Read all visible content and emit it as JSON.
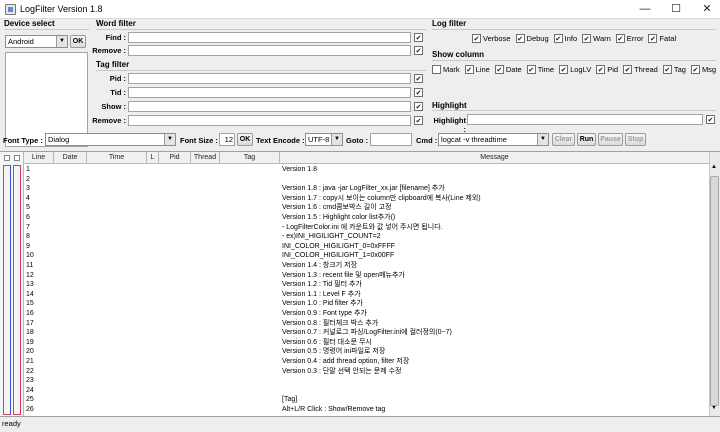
{
  "window": {
    "title": "LogFilter Version 1.8",
    "minimize": "—",
    "maximize": "☐",
    "close": "✕"
  },
  "device_select": {
    "title": "Device select",
    "selected": "Android",
    "ok": "OK"
  },
  "word_filter": {
    "title": "Word filter",
    "find_label": "Find :",
    "remove_label": "Remove :"
  },
  "tag_filter": {
    "title": "Tag filter",
    "pid_label": "Pid :",
    "tid_label": "Tid :",
    "show_label": "Show :",
    "remove_label": "Remove :"
  },
  "log_filter": {
    "title": "Log filter",
    "items": [
      "Verbose",
      "Debug",
      "Info",
      "Warn",
      "Error",
      "Fatal"
    ]
  },
  "show_column": {
    "title": "Show column",
    "items": [
      "Mark",
      "Line",
      "Date",
      "Time",
      "LogLV",
      "Pid",
      "Thread",
      "Tag",
      "Msg"
    ],
    "checked": [
      false,
      true,
      true,
      true,
      true,
      true,
      true,
      true,
      true
    ]
  },
  "highlight": {
    "title": "Highlight",
    "label": "Highlight :"
  },
  "toolbar": {
    "font_type_label": "Font Type :",
    "font_type": "Dialog",
    "font_size_label": "Font Size :",
    "font_size": "12",
    "ok": "OK",
    "encode_label": "Text Encode :",
    "encode": "UTF-8",
    "goto_label": "Goto :",
    "cmd_label": "Cmd :",
    "cmd": "logcat -v threadtime",
    "clear": "Clear",
    "run": "Run",
    "pause": "Pause",
    "stop": "Stop"
  },
  "table": {
    "headers": [
      "Line",
      "Date",
      "Time",
      "L",
      "Pid",
      "Thread",
      "Tag",
      "Message"
    ],
    "rows": [
      [
        "1",
        "Version 1.8"
      ],
      [
        "2",
        ""
      ],
      [
        "3",
        "Version 1.8 : java -jar LogFilter_xx.jar [filename] 추가"
      ],
      [
        "4",
        "Version 1.7 : copy시 보이는 column만 clipboard에 복사(Line 제외)"
      ],
      [
        "5",
        "Version 1.6 : cmd콤보박스 길이 고정"
      ],
      [
        "6",
        "Version 1.5 : Highlight color list추가()"
      ],
      [
        "7",
        "  - LogFilterColor.ini 에 카운트와 값 넣어 주시면 됩니다."
      ],
      [
        "8",
        "  - ex)INI_HIGILIGHT_COUNT=2"
      ],
      [
        "9",
        "      INI_COLOR_HIGILIGHT_0=0xFFFF"
      ],
      [
        "10",
        "      INI_COLOR_HIGILIGHT_1=0x00FF"
      ],
      [
        "11",
        "Version 1.4 : 창크기 저장"
      ],
      [
        "12",
        "Version 1.3 : recent file 및 open메뉴추가"
      ],
      [
        "13",
        "Version 1.2 : Tid 필터 추가"
      ],
      [
        "14",
        "Version 1.1 : Level F 추가"
      ],
      [
        "15",
        "Version 1.0 : Pid filter 추가"
      ],
      [
        "16",
        "Version 0.9 : Font type 추가"
      ],
      [
        "17",
        "Version 0.8 : 필터체크 박스 추가"
      ],
      [
        "18",
        "Version 0.7 : 커널로그 파싱/LogFilter.ini에 컬러정의(0~7)"
      ],
      [
        "19",
        "Version 0.6 : 필터 대소문 무시"
      ],
      [
        "20",
        "Version 0.5 : 명령어 ini파일로 저장"
      ],
      [
        "21",
        "Version 0.4 : add thread option, filter 저장"
      ],
      [
        "22",
        "Version 0.3 : 단말 선택 안되는 문제 수정"
      ],
      [
        "23",
        ""
      ],
      [
        "24",
        ""
      ],
      [
        "25",
        "[Tag]"
      ],
      [
        "26",
        "Alt+L/R Click : Show/Remove tag"
      ]
    ]
  },
  "status": "ready",
  "colors": {
    "mark_bar_left": "#d04060",
    "mark_bar_right": "#3a50c8"
  }
}
